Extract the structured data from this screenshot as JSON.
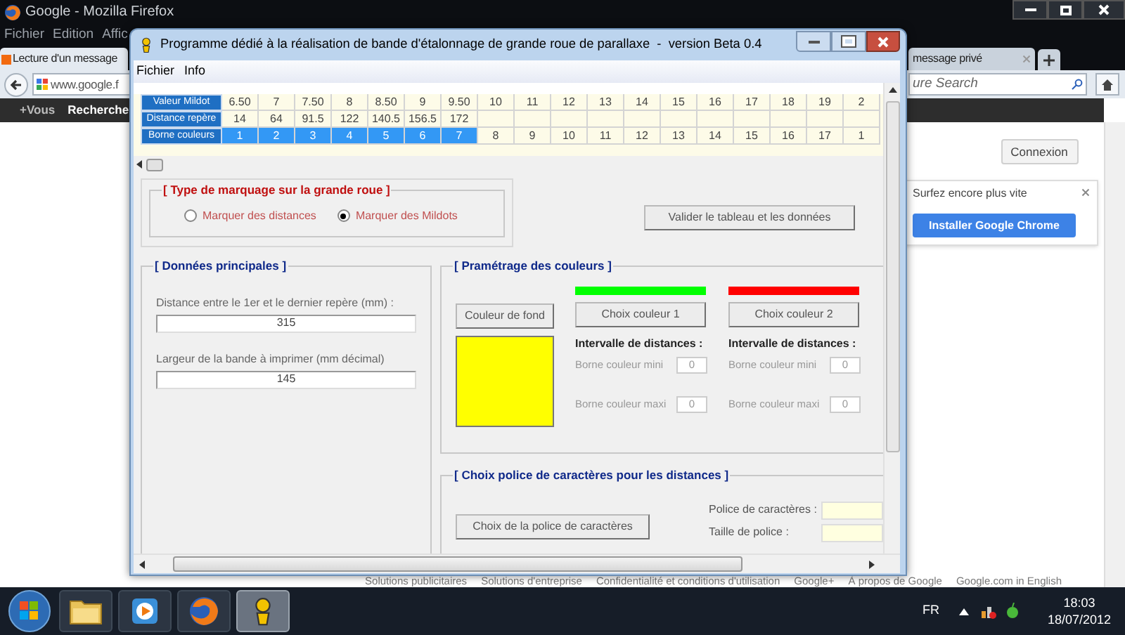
{
  "browser": {
    "title": "Google - Mozilla Firefox",
    "menu": [
      "Fichier",
      "Edition",
      "Affic"
    ],
    "tabs": [
      {
        "label": "Lecture d'un message",
        "selected": true
      },
      {
        "label": "message privé",
        "selected": false
      }
    ],
    "url": "www.google.f",
    "search": {
      "placeholder": "ure Search"
    },
    "nav": [
      "+Vous",
      "Recherche"
    ],
    "sign_in": "Connexion",
    "promo": {
      "text": "Surfez encore plus vite",
      "button": "Installer Google Chrome"
    },
    "footer": [
      "Solutions publicitaires",
      "Solutions d'entreprise",
      "Confidentialité et conditions d'utilisation",
      "Google+",
      "À propos de Google",
      "Google.com in English"
    ]
  },
  "app": {
    "title": "Programme dédié à la réalisation de bande d'étalonnage de grande roue de parallaxe  -  version Beta 0.4",
    "menu": [
      "Fichier",
      "Info"
    ],
    "grid": {
      "row_headers": [
        "Valeur Mildot",
        "Distance repère",
        "Borne couleurs"
      ],
      "columns": [
        {
          "mildot": "6.50",
          "distance": "14",
          "borne": "1",
          "selected": true
        },
        {
          "mildot": "7",
          "distance": "64",
          "borne": "2",
          "selected": true
        },
        {
          "mildot": "7.50",
          "distance": "91.5",
          "borne": "3",
          "selected": true
        },
        {
          "mildot": "8",
          "distance": "122",
          "borne": "4",
          "selected": true
        },
        {
          "mildot": "8.50",
          "distance": "140.5",
          "borne": "5",
          "selected": true
        },
        {
          "mildot": "9",
          "distance": "156.5",
          "borne": "6",
          "selected": true
        },
        {
          "mildot": "9.50",
          "distance": "172",
          "borne": "7",
          "selected": true
        },
        {
          "mildot": "10",
          "borne": "8",
          "selected": false
        },
        {
          "mildot": "11",
          "borne": "9",
          "selected": false
        },
        {
          "mildot": "12",
          "borne": "10",
          "selected": false
        },
        {
          "mildot": "13",
          "borne": "11",
          "selected": false
        },
        {
          "mildot": "14",
          "borne": "12",
          "selected": false
        },
        {
          "mildot": "15",
          "borne": "13",
          "selected": false
        },
        {
          "mildot": "16",
          "borne": "14",
          "selected": false
        },
        {
          "mildot": "17",
          "borne": "15",
          "selected": false
        },
        {
          "mildot": "18",
          "borne": "16",
          "selected": false
        },
        {
          "mildot": "19",
          "borne": "17",
          "selected": false
        },
        {
          "mildot": "2",
          "borne": "1",
          "selected": false
        }
      ]
    },
    "marking": {
      "title": "[ Type de marquage sur la grande roue ]",
      "options": [
        {
          "label": "Marquer des distances",
          "selected": false
        },
        {
          "label": "Marquer des Mildots",
          "selected": true
        }
      ]
    },
    "validate_button": "Valider le tableau et les données",
    "main_data": {
      "title": "[ Données principales ]",
      "fields": [
        {
          "label": "Distance entre le 1er et le dernier repère (mm) :",
          "value": "315"
        },
        {
          "label": "Largeur de la bande à imprimer (mm décimal)",
          "value": "145"
        }
      ]
    },
    "colors": {
      "title": "[ Pramétrage des couleurs ]",
      "background": {
        "button": "Couleur de fond",
        "color": "#ffff00"
      },
      "choices": [
        {
          "color": "#00ff00",
          "button": "Choix couleur 1",
          "interval_title": "Intervalle de distances :",
          "min_label": "Borne couleur mini",
          "min": "0",
          "max_label": "Borne couleur maxi",
          "max": "0"
        },
        {
          "color": "#ff0000",
          "button": "Choix couleur 2",
          "interval_title": "Intervalle de distances :",
          "min_label": "Borne couleur mini",
          "min": "0",
          "max_label": "Borne couleur maxi",
          "max": "0"
        }
      ]
    },
    "font": {
      "title": "[ Choix police de caractères pour les distances ]",
      "button": "Choix de la police de caractères",
      "fields": [
        {
          "label": "Police de caractères :"
        },
        {
          "label": "Taille de police :"
        }
      ]
    }
  },
  "taskbar": {
    "apps": [
      {
        "kind": "folder",
        "selected": false
      },
      {
        "kind": "media",
        "selected": false
      },
      {
        "kind": "firefox",
        "selected": false
      },
      {
        "kind": "app",
        "selected": true
      }
    ],
    "language": "FR",
    "time": "18:03",
    "date": "18/07/2012"
  }
}
